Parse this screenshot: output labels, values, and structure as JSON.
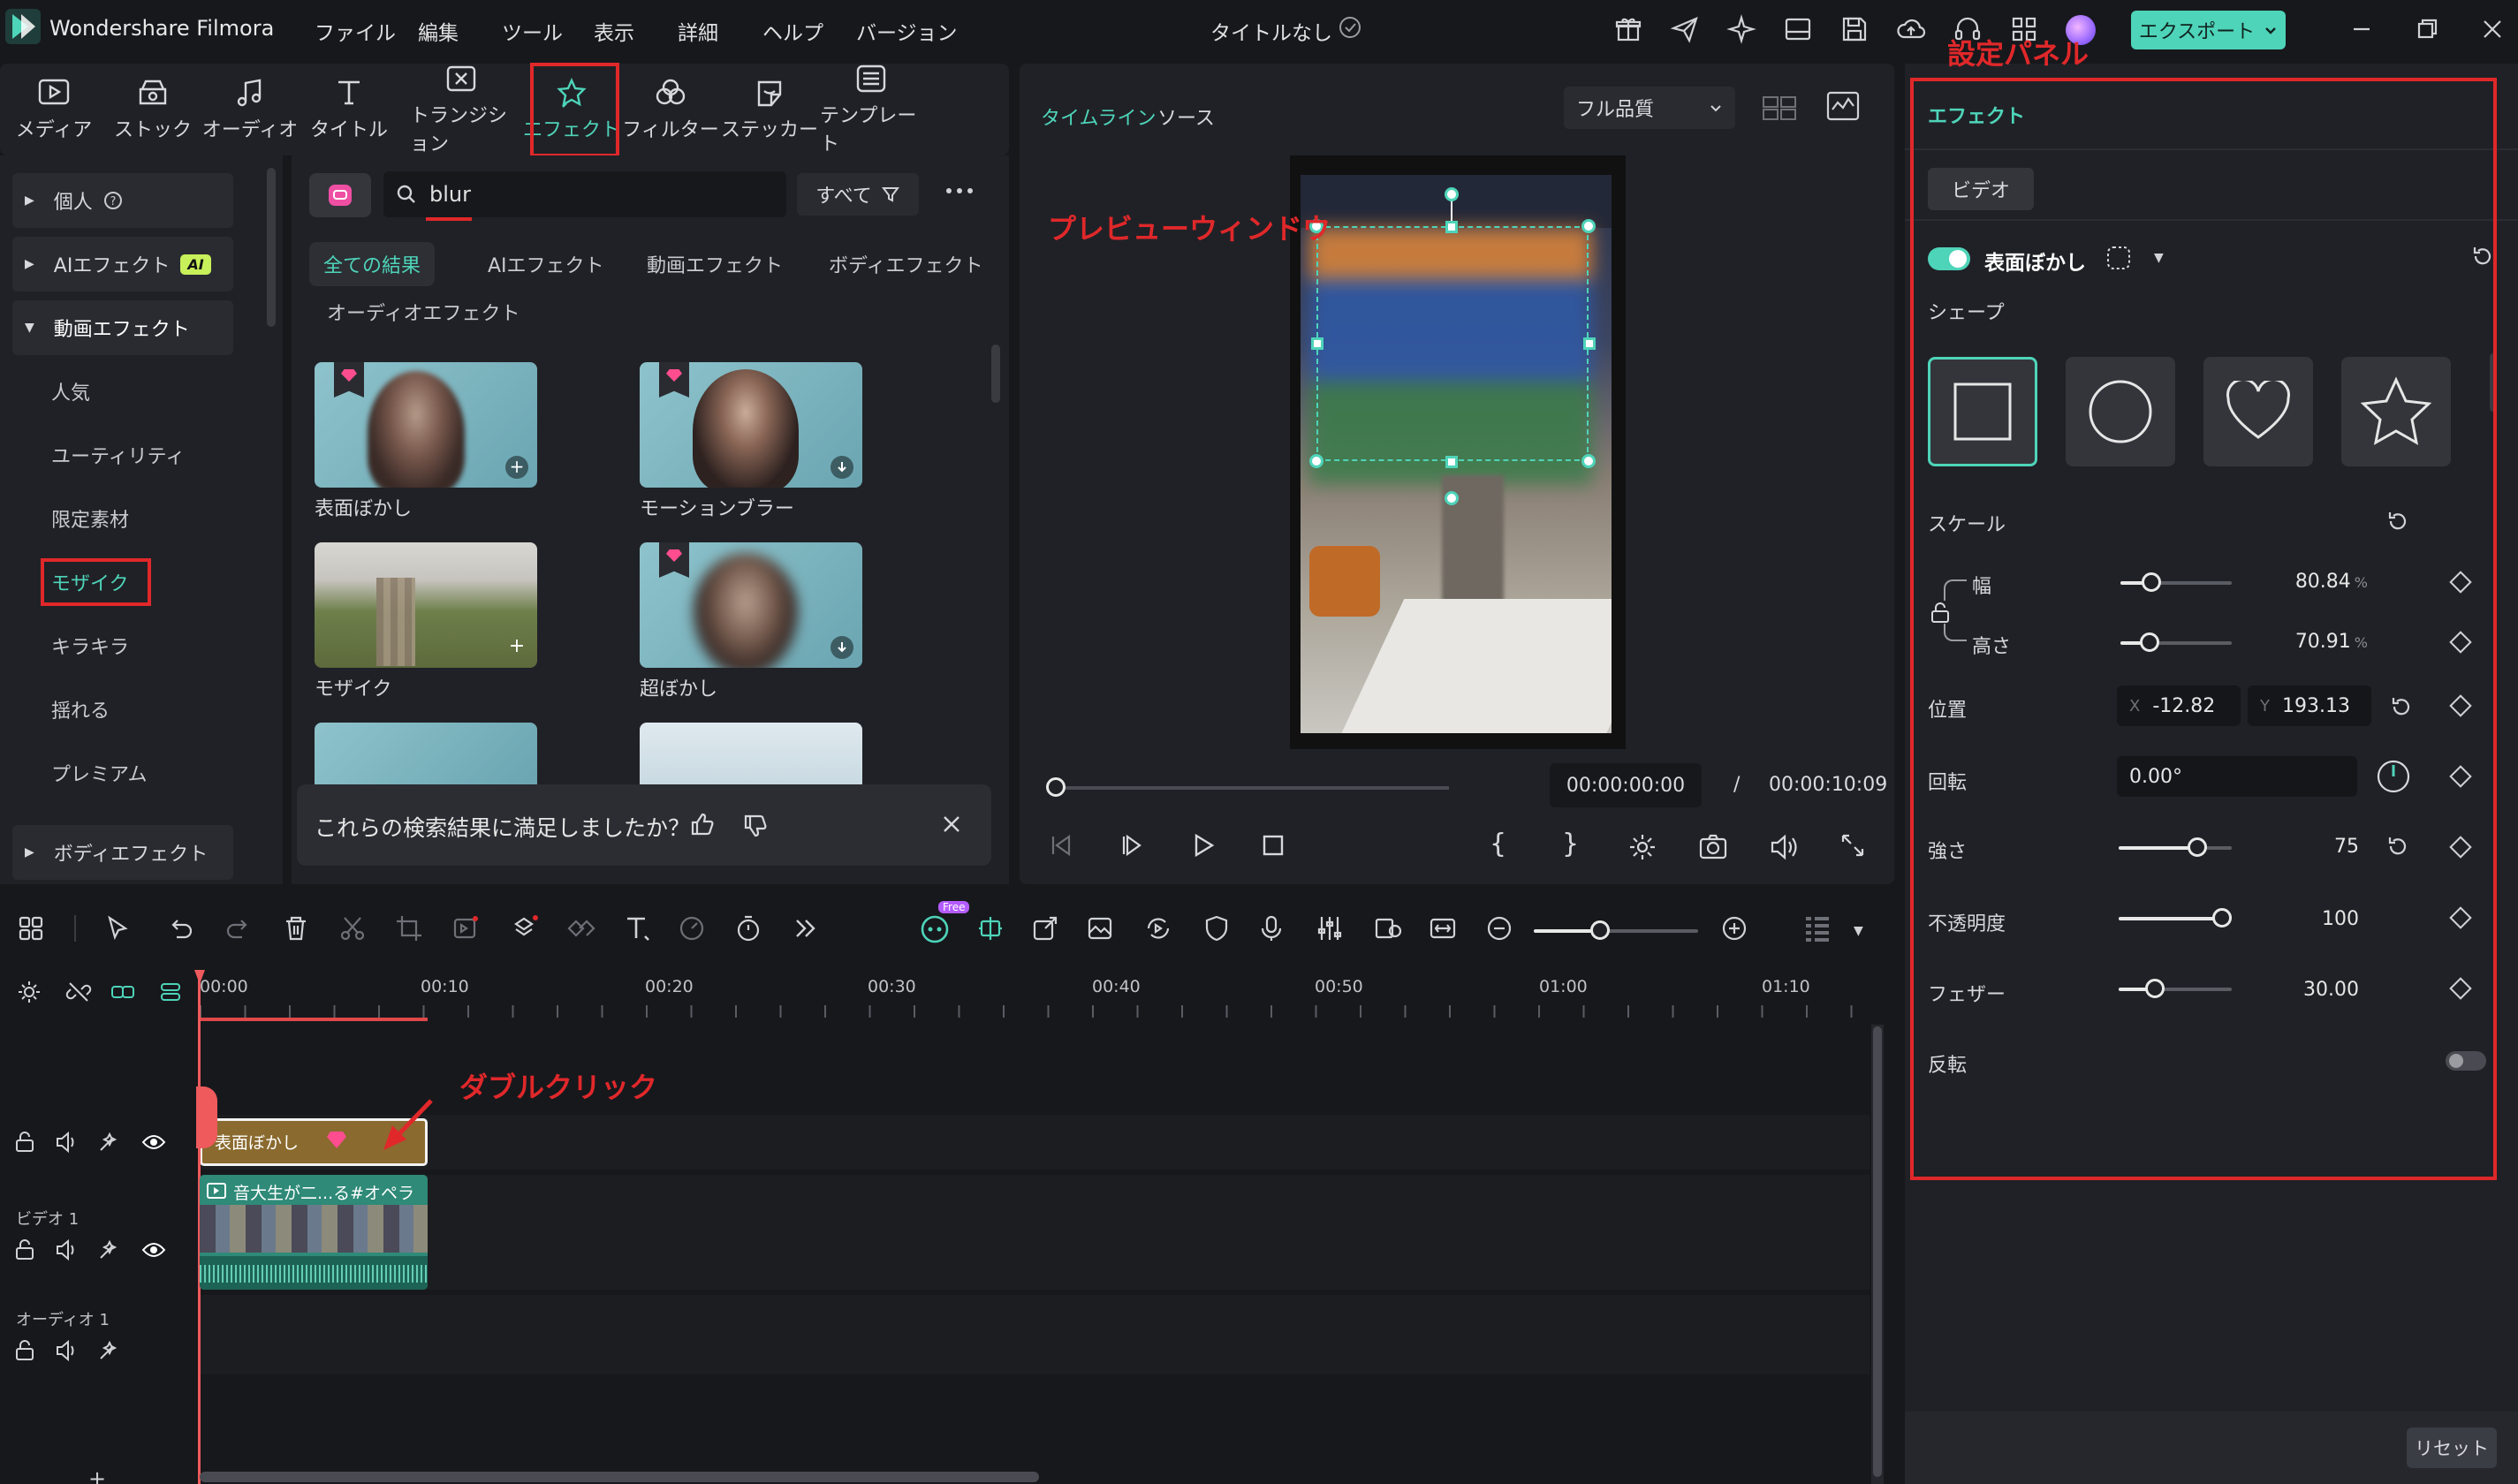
{
  "app": {
    "name": "Wondershare Filmora",
    "doc_title": "タイトルなし",
    "export_label": "エクスポート"
  },
  "menu": [
    "ファイル",
    "編集",
    "ツール",
    "表示",
    "詳細",
    "ヘルプ",
    "バージョン"
  ],
  "media_tabs": [
    {
      "label": "メディア",
      "icon": "media-icon"
    },
    {
      "label": "ストック",
      "icon": "stock-icon"
    },
    {
      "label": "オーディオ",
      "icon": "audio-icon"
    },
    {
      "label": "タイトル",
      "icon": "title-icon"
    },
    {
      "label": "トランジション",
      "icon": "transition-icon"
    },
    {
      "label": "エフェクト",
      "icon": "effects-icon",
      "active": true
    },
    {
      "label": "フィルター",
      "icon": "filter-icon"
    },
    {
      "label": "ステッカー",
      "icon": "sticker-icon"
    },
    {
      "label": "テンプレート",
      "icon": "template-icon"
    }
  ],
  "left_nav": {
    "personal": "個人",
    "ai_effects": "AIエフェクト",
    "ai_badge": "AI",
    "video_effects": "動画エフェクト",
    "sub": [
      "人気",
      "ユーティリティ",
      "限定素材",
      "モザイク",
      "キラキラ",
      "揺れる",
      "プレミアム"
    ],
    "body_effects": "ボディエフェクト"
  },
  "search": {
    "value": "blur",
    "all_label": "すべて"
  },
  "filters": [
    "全ての結果",
    "AIエフェクト",
    "動画エフェクト",
    "ボディエフェクト",
    "オーディオエフェクト"
  ],
  "results": [
    {
      "label": "表面ぼかし"
    },
    {
      "label": "モーションブラー"
    },
    {
      "label": "モザイク"
    },
    {
      "label": "超ぼかし"
    }
  ],
  "feedback": {
    "text": "これらの検索結果に満足しましたか？"
  },
  "preview": {
    "tab_timeline": "タイムライン",
    "tab_source": "ソース",
    "quality": "フル品質",
    "current_time": "00:00:00:00",
    "separator": "/",
    "total_time": "00:00:10:09"
  },
  "annotations": {
    "settings_panel": "設定パネル",
    "preview_window": "プレビューウィンドウ",
    "double_click": "ダブルクリック"
  },
  "properties": {
    "title": "エフェクト",
    "tab_video": "ビデオ",
    "effect_name": "表面ぼかし",
    "shape_label": "シェープ",
    "shapes": [
      "square-shape-icon",
      "circle-shape-icon",
      "heart-shape-icon",
      "star-shape-icon"
    ],
    "scale_label": "スケール",
    "width_label": "幅",
    "width_value": "80.84",
    "height_label": "高さ",
    "height_value": "70.91",
    "percent": "%",
    "position_label": "位置",
    "x_label": "X",
    "x_value": "-12.82",
    "y_label": "Y",
    "y_value": "193.13",
    "rotation_label": "回転",
    "rotation_value": "0.00°",
    "strength_label": "強さ",
    "strength_value": "75",
    "opacity_label": "不透明度",
    "opacity_value": "100",
    "feather_label": "フェザー",
    "feather_value": "30.00",
    "invert_label": "反転",
    "reset_label": "リセット"
  },
  "timeline": {
    "ticks": [
      "00:00",
      "00:10",
      "00:20",
      "00:30",
      "00:40",
      "00:50",
      "01:00",
      "01:10"
    ],
    "effect_clip": "表面ぼかし",
    "video_clip": "音大生が二...る#オペラ",
    "track_video": "ビデオ 1",
    "track_audio": "オーディオ 1",
    "free_badge": "Free"
  },
  "colors": {
    "accent": "#4ed4b9",
    "annotation": "#e0282a",
    "effect_clip": "#8a6a2e",
    "video_clip": "#2f8a78"
  }
}
